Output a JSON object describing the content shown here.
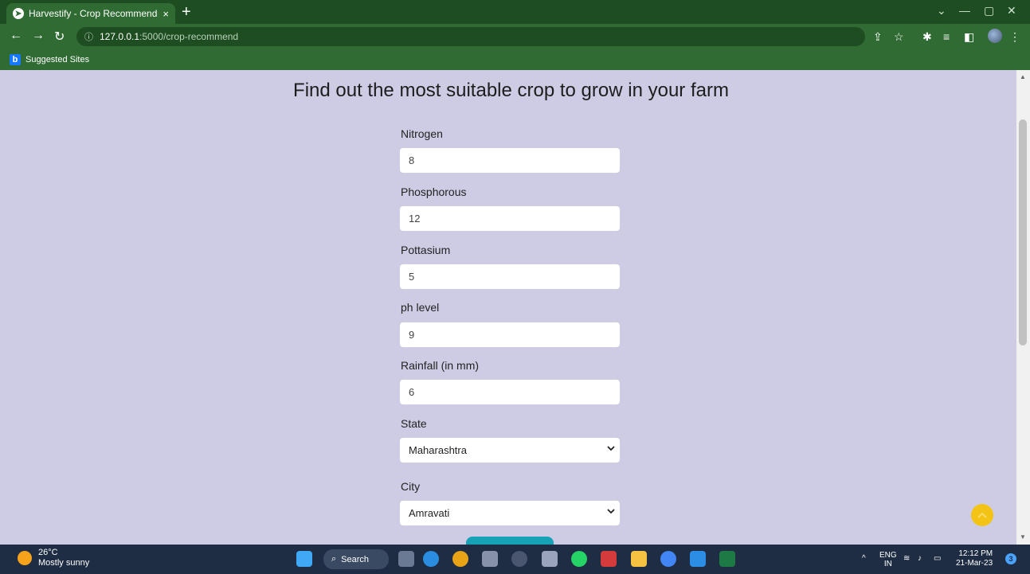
{
  "browser": {
    "tab_title": "Harvestify - Crop Recommendati",
    "tab_close": "×",
    "new_tab": "+",
    "url_host": "127.0.0.1",
    "url_path": ":5000/crop-recommend",
    "bookmark_label": "Suggested Sites",
    "bookmark_icon": "b"
  },
  "page": {
    "heading": "Find out the most suitable crop to grow in your farm",
    "fields": [
      {
        "label": "Nitrogen",
        "value": "8"
      },
      {
        "label": "Phosphorous",
        "value": "12"
      },
      {
        "label": "Pottasium",
        "value": "5"
      },
      {
        "label": "ph level",
        "value": "9"
      },
      {
        "label": "Rainfall (in mm)",
        "value": "6"
      }
    ],
    "state": {
      "label": "State",
      "selected": "Maharashtra"
    },
    "city": {
      "label": "City",
      "selected": "Amravati"
    }
  },
  "taskbar": {
    "temperature": "26°C",
    "weather": "Mostly sunny",
    "search": "Search",
    "lang_top": "ENG",
    "lang_bottom": "IN",
    "time": "12:12 PM",
    "date": "21-Mar-23",
    "notifications": "3"
  },
  "colors": {
    "page_bg": "#cecce4",
    "chrome_dark": "#1e4d21",
    "chrome": "#2f6b32",
    "accent_button": "#17a2b8",
    "to_top": "#f3c315"
  }
}
